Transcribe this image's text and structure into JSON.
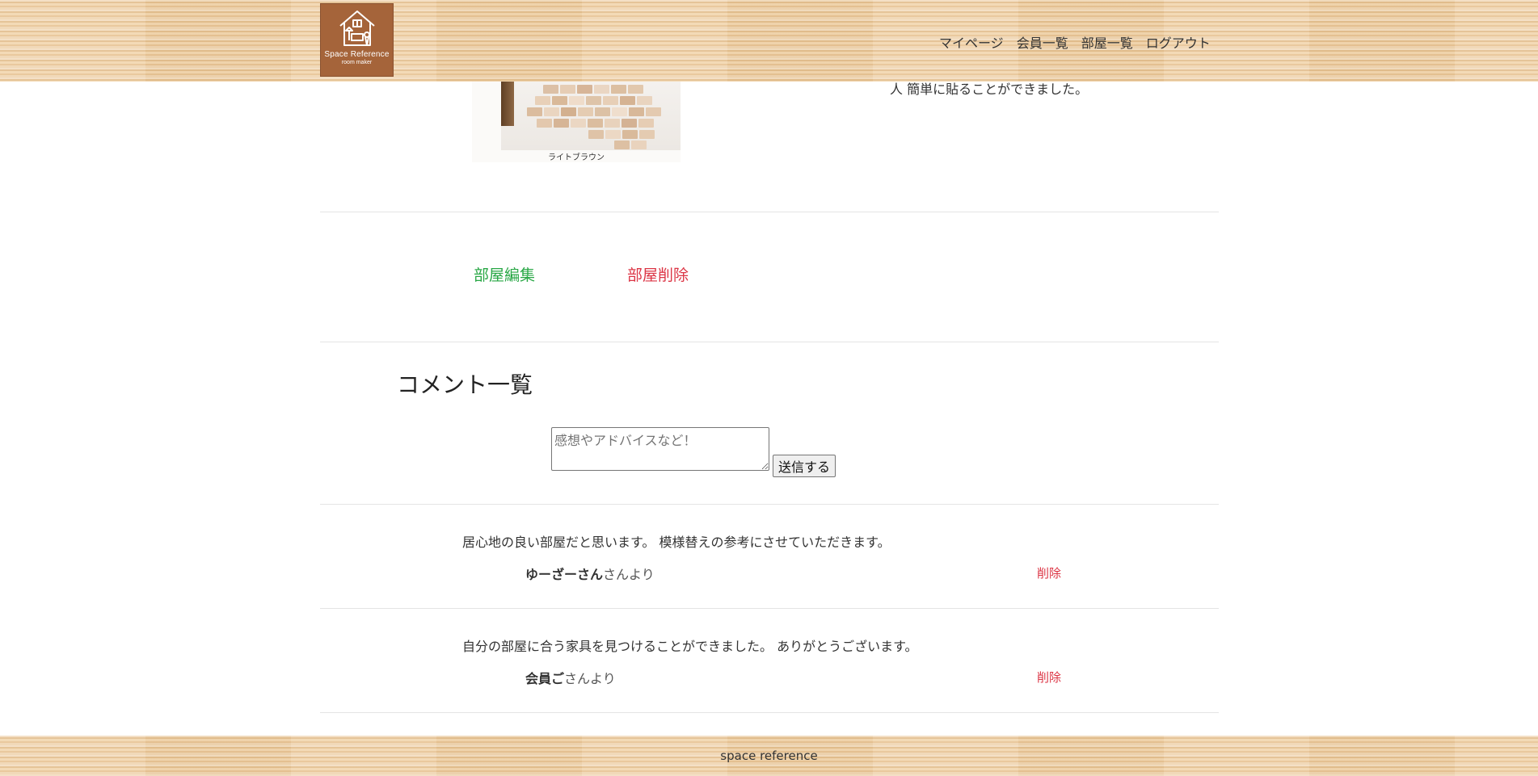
{
  "header": {
    "logo_title": "Space Reference",
    "logo_subtitle": "room maker",
    "nav": {
      "mypage": "マイページ",
      "members": "会員一覧",
      "rooms": "部屋一覧",
      "logout": "ログアウト"
    }
  },
  "room": {
    "photo_caption": "ライトブラウン",
    "description_tail": "人 簡単に貼ることができました。"
  },
  "actions": {
    "edit_label": "部屋編集",
    "delete_label": "部屋削除"
  },
  "comments": {
    "title": "コメント一覧",
    "input_placeholder": "感想やアドバイスなど！",
    "input_value": "",
    "submit_label": "送信する",
    "from_suffix": "さんより",
    "delete_label": "削除",
    "items": [
      {
        "text": "居心地の良い部屋だと思います。 模様替えの参考にさせていただきます。",
        "author": "ゆーざーさん"
      },
      {
        "text": "自分の部屋に合う家具を見つけることができました。 ありがとうございます。",
        "author": "会員ご"
      }
    ]
  },
  "footer": {
    "text": "space reference"
  },
  "colors": {
    "edit": "#28a745",
    "delete": "#dc3545",
    "logo_bg": "#a5643a",
    "wood": "#eccb9e"
  }
}
